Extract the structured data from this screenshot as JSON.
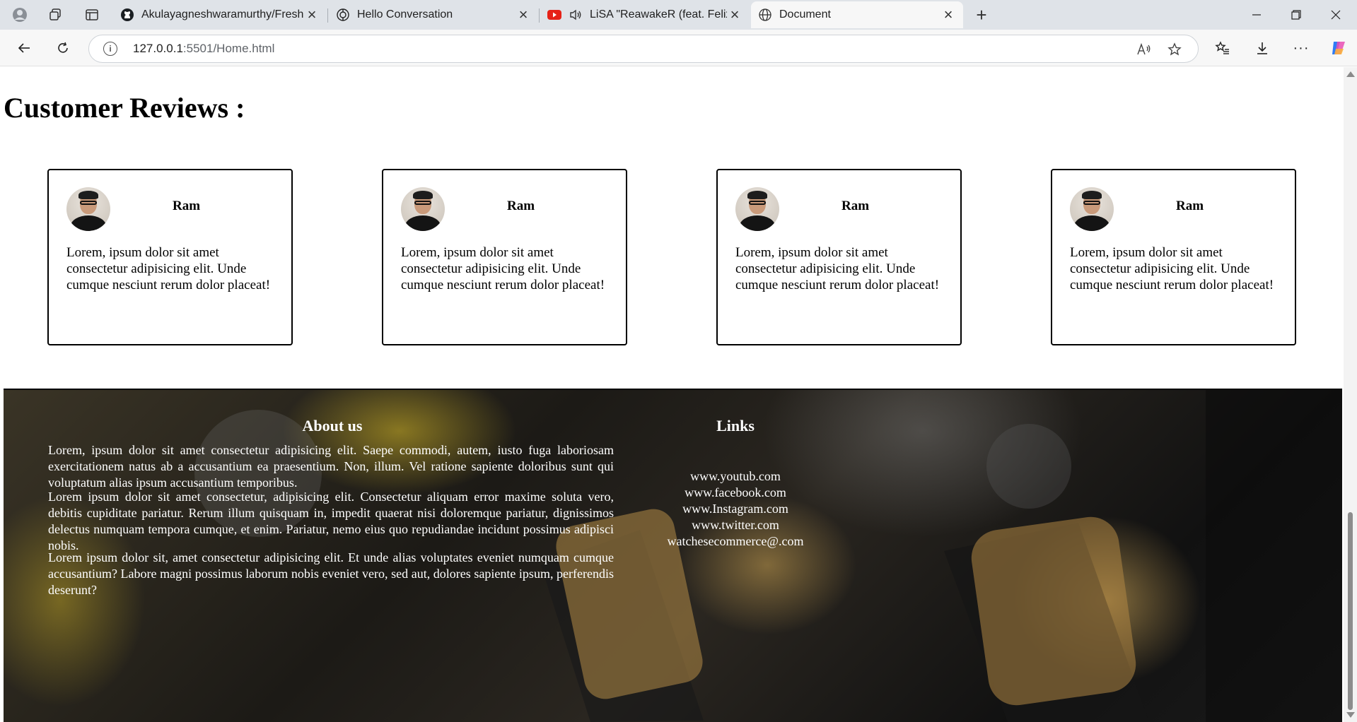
{
  "browser": {
    "tabs": [
      {
        "title": "Akulayagneshwaramurthy/Fresh-I",
        "icon": "github-icon"
      },
      {
        "title": "Hello Conversation",
        "icon": "chatgpt-icon"
      },
      {
        "title": "LiSA \"ReawakeR (feat. Felix of",
        "icon": "youtube-icon"
      },
      {
        "title": "Document",
        "icon": "globe-icon"
      }
    ],
    "url_host": "127.0.0.1",
    "url_rest": ":5501/Home.html",
    "read_aloud_label": "Á́"
  },
  "page": {
    "reviews_heading": "Customer Reviews :",
    "reviews": [
      {
        "name": "Ram",
        "text": "Lorem, ipsum dolor sit amet consectetur adipisicing elit. Unde cumque nesciunt rerum dolor placeat!"
      },
      {
        "name": "Ram",
        "text": "Lorem, ipsum dolor sit amet consectetur adipisicing elit. Unde cumque nesciunt rerum dolor placeat!"
      },
      {
        "name": "Ram",
        "text": "Lorem, ipsum dolor sit amet consectetur adipisicing elit. Unde cumque nesciunt rerum dolor placeat!"
      },
      {
        "name": "Ram",
        "text": "Lorem, ipsum dolor sit amet consectetur adipisicing elit. Unde cumque nesciunt rerum dolor placeat!"
      }
    ],
    "footer": {
      "about_title": "About us",
      "about_paragraphs": [
        "Lorem, ipsum dolor sit amet consectetur adipisicing elit. Saepe commodi, autem, iusto fuga laboriosam exercitationem natus ab a accusantium ea praesentium. Non, illum. Vel ratione sapiente doloribus sunt qui voluptatum alias ipsum accusantium temporibus.",
        "Lorem ipsum dolor sit amet consectetur, adipisicing elit. Consectetur aliquam error maxime soluta vero, debitis cupiditate pariatur. Rerum illum quisquam in, impedit quaerat nisi doloremque pariatur, dignissimos delectus numquam tempora cumque, et enim. Pariatur, nemo eius quo repudiandae incidunt possimus adipisci nobis.",
        "Lorem ipsum dolor sit, amet consectetur adipisicing elit. Et unde alias voluptates eveniet numquam cumque accusantium? Labore magni possimus laborum nobis eveniet vero, sed aut, dolores sapiente ipsum, perferendis deserunt?"
      ],
      "links_title": "Links",
      "links": [
        "www.youtub.com",
        "www.facebook.com",
        "www.Instagram.com",
        "www.twitter.com",
        "watchesecommerce@.com"
      ]
    }
  }
}
